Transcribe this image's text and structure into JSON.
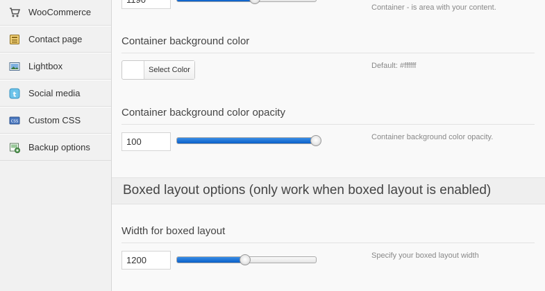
{
  "sidebar": {
    "items": [
      {
        "label": "WooCommerce",
        "icon": "cart-icon"
      },
      {
        "label": "Contact page",
        "icon": "contact-card-icon"
      },
      {
        "label": "Lightbox",
        "icon": "picture-icon"
      },
      {
        "label": "Social media",
        "icon": "twitter-icon"
      },
      {
        "label": "Custom CSS",
        "icon": "css-icon"
      },
      {
        "label": "Backup options",
        "icon": "backup-icon"
      }
    ]
  },
  "top_section": {
    "input_value": "1190",
    "slider_fraction": 0.56,
    "hint": "Container - is area with your content."
  },
  "bg_color": {
    "title": "Container background color",
    "button_label": "Select Color",
    "swatch_color": "#ffffff",
    "hint": "Default: #ffffff"
  },
  "bg_opacity": {
    "title": "Container background color opacity",
    "input_value": "100",
    "slider_fraction": 1.0,
    "hint": "Container background color opacity."
  },
  "boxed": {
    "header": "Boxed layout options (only work when boxed layout is enabled)",
    "width_title": "Width for boxed layout",
    "input_value": "1200",
    "slider_fraction": 0.49,
    "hint": "Specify your boxed layout width"
  },
  "colors": {
    "slider_fill": "#1a6fd6",
    "sidebar_bg": "#f1f1f1"
  }
}
